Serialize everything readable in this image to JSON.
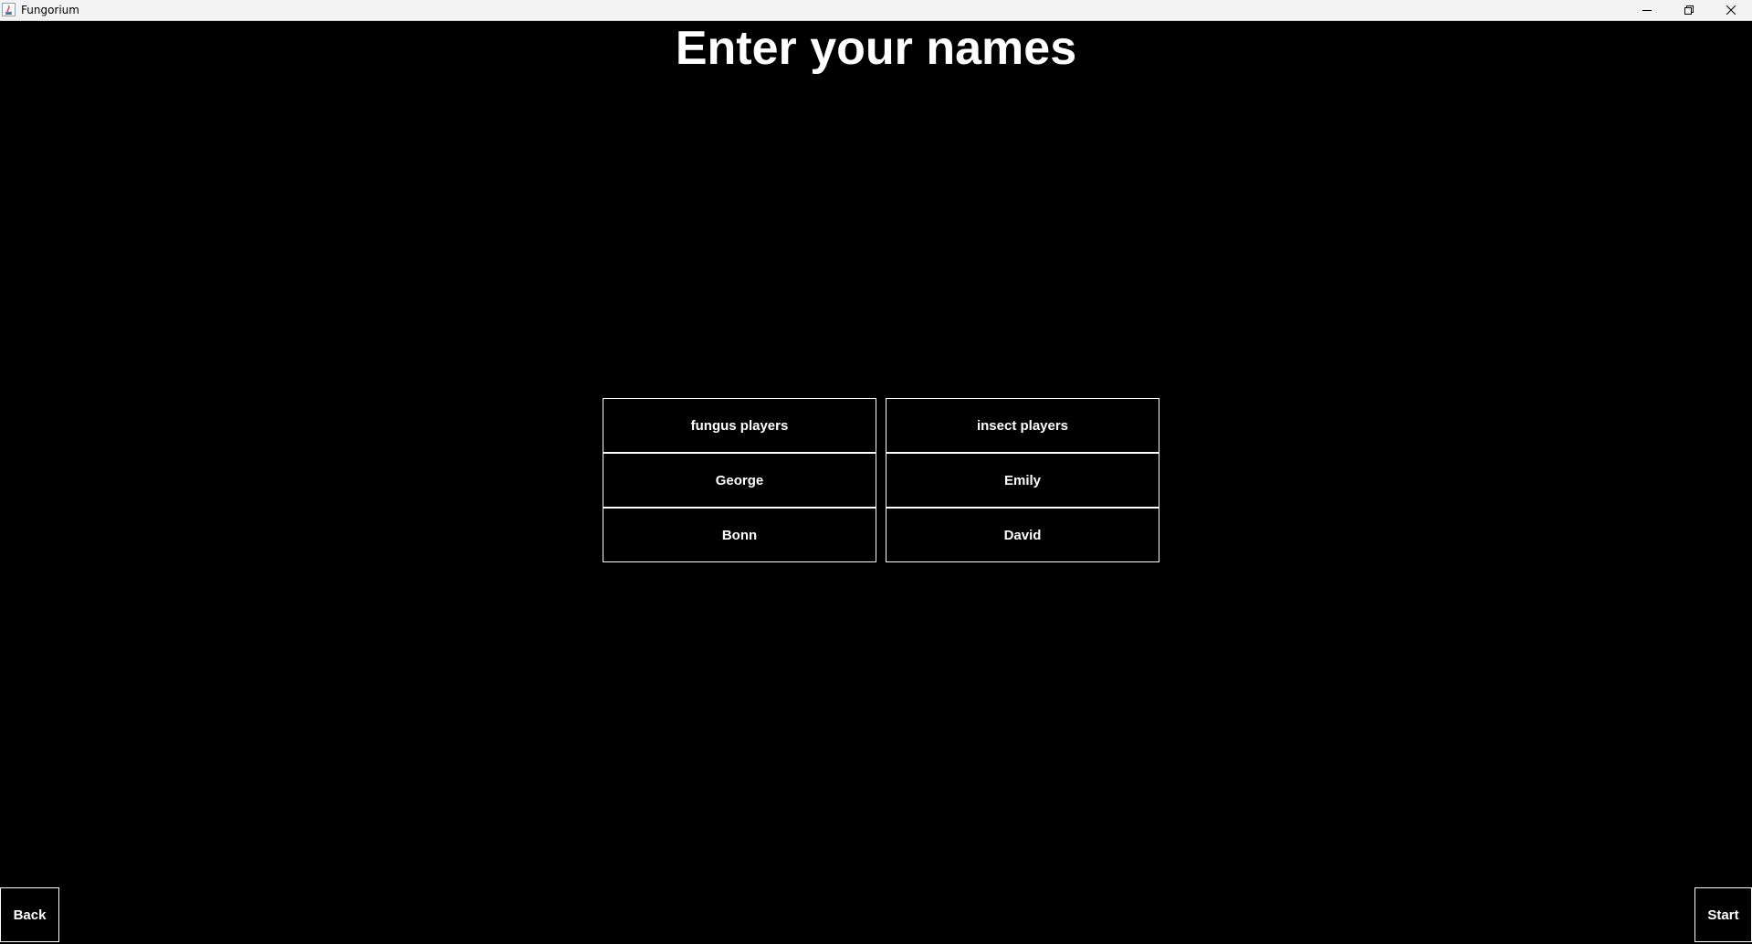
{
  "window": {
    "title": "Fungorium",
    "controls": [
      "minimize-icon",
      "restore-icon",
      "close-icon"
    ]
  },
  "page": {
    "title": "Enter your names"
  },
  "players": {
    "fungus": {
      "header": "fungus players",
      "names": [
        "George",
        "Bonn"
      ]
    },
    "insect": {
      "header": "insect players",
      "names": [
        "Emily",
        "David"
      ]
    }
  },
  "nav": {
    "back_label": "Back",
    "start_label": "Start"
  },
  "colors": {
    "background": "#000000",
    "foreground": "#ffffff",
    "titlebar": "#f3f3f3"
  }
}
